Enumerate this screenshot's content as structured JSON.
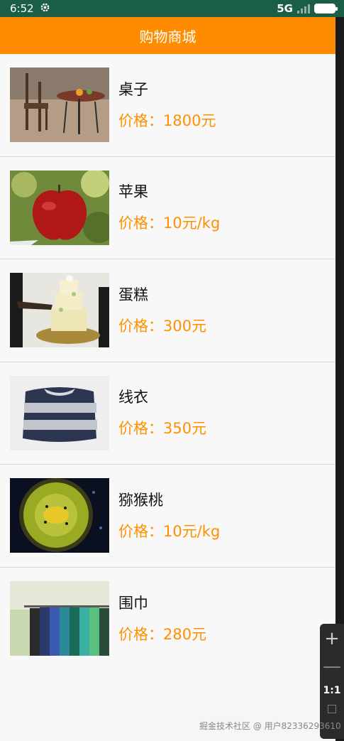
{
  "status_bar": {
    "time": "6:52",
    "network": "5G",
    "icons": [
      "settings-icon",
      "signal-icon",
      "battery-icon"
    ]
  },
  "app_bar": {
    "title": "购物商城"
  },
  "items": [
    {
      "name": "桌子",
      "price": "价格：1800元",
      "image": "table-chairs-photo"
    },
    {
      "name": "苹果",
      "price": "价格：10元/kg",
      "image": "apple-photo"
    },
    {
      "name": "蛋糕",
      "price": "价格：300元",
      "image": "cake-photo"
    },
    {
      "name": "线衣",
      "price": "价格：350元",
      "image": "sweater-photo"
    },
    {
      "name": "猕猴桃",
      "price": "价格：10元/kg",
      "image": "kiwi-photo"
    },
    {
      "name": "围巾",
      "price": "价格：280元",
      "image": "scarves-photo"
    }
  ],
  "zoom_panel": {
    "plus": "+",
    "minus": "—",
    "level": "1:1"
  },
  "watermark": "掘金技术社区 @ 用户82336293610",
  "colors": {
    "app_bar": "#ff8c00",
    "price": "#ff9000",
    "status_bar": "#1a5e45"
  }
}
